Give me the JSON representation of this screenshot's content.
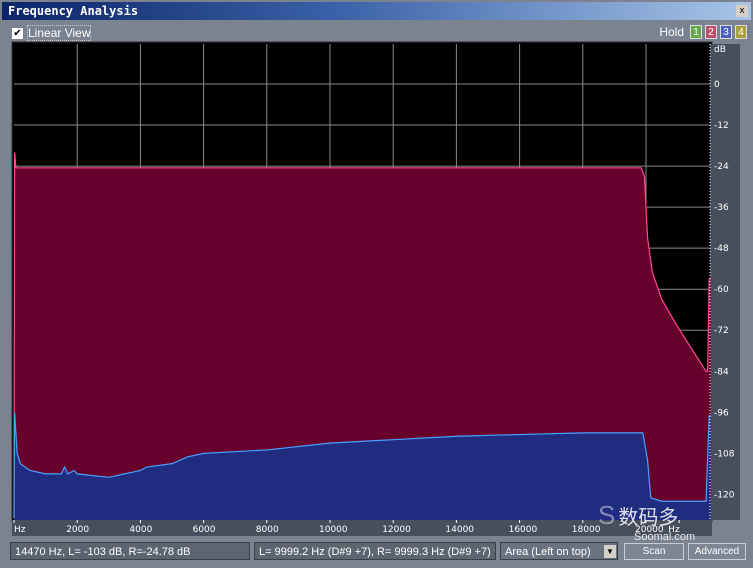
{
  "window": {
    "title": "Frequency Analysis",
    "close": "x"
  },
  "toolbar": {
    "linear_view_label": "Linear View",
    "linear_view_checked": true,
    "hold_label": "Hold",
    "hold_buttons": [
      {
        "label": "1",
        "color": "#6aa84f"
      },
      {
        "label": "2",
        "color": "#c0506a"
      },
      {
        "label": "3",
        "color": "#5060c0"
      },
      {
        "label": "4",
        "color": "#a8a040"
      }
    ]
  },
  "chart_data": {
    "type": "area",
    "xlabel": "Hz",
    "ylabel": "dB",
    "x_ticks": [
      "Hz",
      "2000",
      "4000",
      "6000",
      "8000",
      "10000",
      "12000",
      "14000",
      "16000",
      "18000",
      "20000",
      "Hz"
    ],
    "y_ticks": [
      "0",
      "-12",
      "-24",
      "-36",
      "-48",
      "-60",
      "-72",
      "-84",
      "-96",
      "-108",
      "-120"
    ],
    "xlim": [
      0,
      22050
    ],
    "ylim": [
      -127,
      12
    ],
    "grid": true,
    "series": [
      {
        "channel": "right",
        "color": "#68002c",
        "line": "#ff4a90",
        "points": [
          [
            0,
            -127
          ],
          [
            20,
            -20
          ],
          [
            60,
            -24.5
          ],
          [
            19850,
            -24.5
          ],
          [
            19950,
            -27
          ],
          [
            20050,
            -45
          ],
          [
            20200,
            -55
          ],
          [
            20500,
            -63
          ],
          [
            21000,
            -71
          ],
          [
            21900,
            -84
          ],
          [
            21950,
            -84
          ],
          [
            22000,
            -57
          ],
          [
            22050,
            -57
          ]
        ]
      },
      {
        "channel": "left",
        "color": "#1f2c80",
        "line": "#4aa0ff",
        "points": [
          [
            0,
            -127
          ],
          [
            20,
            -96
          ],
          [
            100,
            -108
          ],
          [
            200,
            -111
          ],
          [
            500,
            -113
          ],
          [
            1000,
            -114
          ],
          [
            1500,
            -114
          ],
          [
            1600,
            -112
          ],
          [
            1700,
            -114
          ],
          [
            1900,
            -113
          ],
          [
            2000,
            -114
          ],
          [
            3000,
            -115
          ],
          [
            3500,
            -114
          ],
          [
            4000,
            -113
          ],
          [
            4200,
            -112
          ],
          [
            5000,
            -111
          ],
          [
            5500,
            -109
          ],
          [
            6000,
            -108
          ],
          [
            8000,
            -107
          ],
          [
            10000,
            -105
          ],
          [
            12000,
            -104
          ],
          [
            14000,
            -103
          ],
          [
            16000,
            -102.5
          ],
          [
            18000,
            -102
          ],
          [
            19900,
            -102
          ],
          [
            20050,
            -110
          ],
          [
            20150,
            -121
          ],
          [
            20500,
            -122
          ],
          [
            21900,
            -122
          ],
          [
            22000,
            -97
          ],
          [
            22050,
            -97
          ]
        ]
      }
    ]
  },
  "status": {
    "cursor": "14470 Hz, L=  -103 dB, R=-24.78 dB",
    "peak": "L= 9999.2 Hz (D#9 +7), R= 9999.3 Hz (D#9 +7)",
    "mode": "Area (Left on top)",
    "scan": "Scan",
    "advanced": "Advanced"
  },
  "watermark": "数码多 Soomal.com"
}
